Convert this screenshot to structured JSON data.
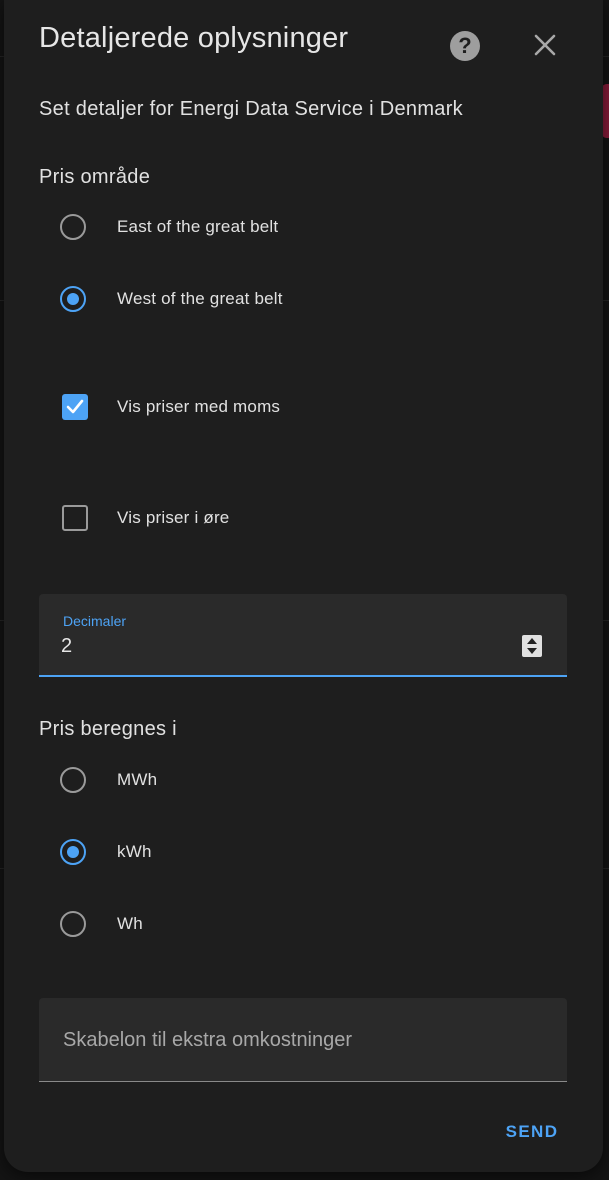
{
  "dialog": {
    "title": "Detaljerede oplysninger",
    "subtitle": "Set detaljer for Energi Data Service i Denmark",
    "help_icon": "help-circle-icon",
    "close_icon": "close-icon"
  },
  "price_area": {
    "label": "Pris område",
    "options": [
      {
        "label": "East of the great belt",
        "checked": false
      },
      {
        "label": "West of the great belt",
        "checked": true
      }
    ]
  },
  "checkboxes": [
    {
      "label": "Vis priser med moms",
      "checked": true
    },
    {
      "label": "Vis priser i øre",
      "checked": false
    }
  ],
  "decimals": {
    "label": "Decimaler",
    "value": "2"
  },
  "price_unit": {
    "label": "Pris beregnes i",
    "options": [
      {
        "label": "MWh",
        "checked": false
      },
      {
        "label": "kWh",
        "checked": true
      },
      {
        "label": "Wh",
        "checked": false
      }
    ]
  },
  "template_field": {
    "placeholder": "Skabelon til ekstra omkostninger",
    "value": ""
  },
  "actions": {
    "send_label": "SEND"
  },
  "colors": {
    "accent": "#4da3f5",
    "surface": "#1e1e1e",
    "field": "#2a2a2a",
    "text": "#e1e1e1"
  }
}
